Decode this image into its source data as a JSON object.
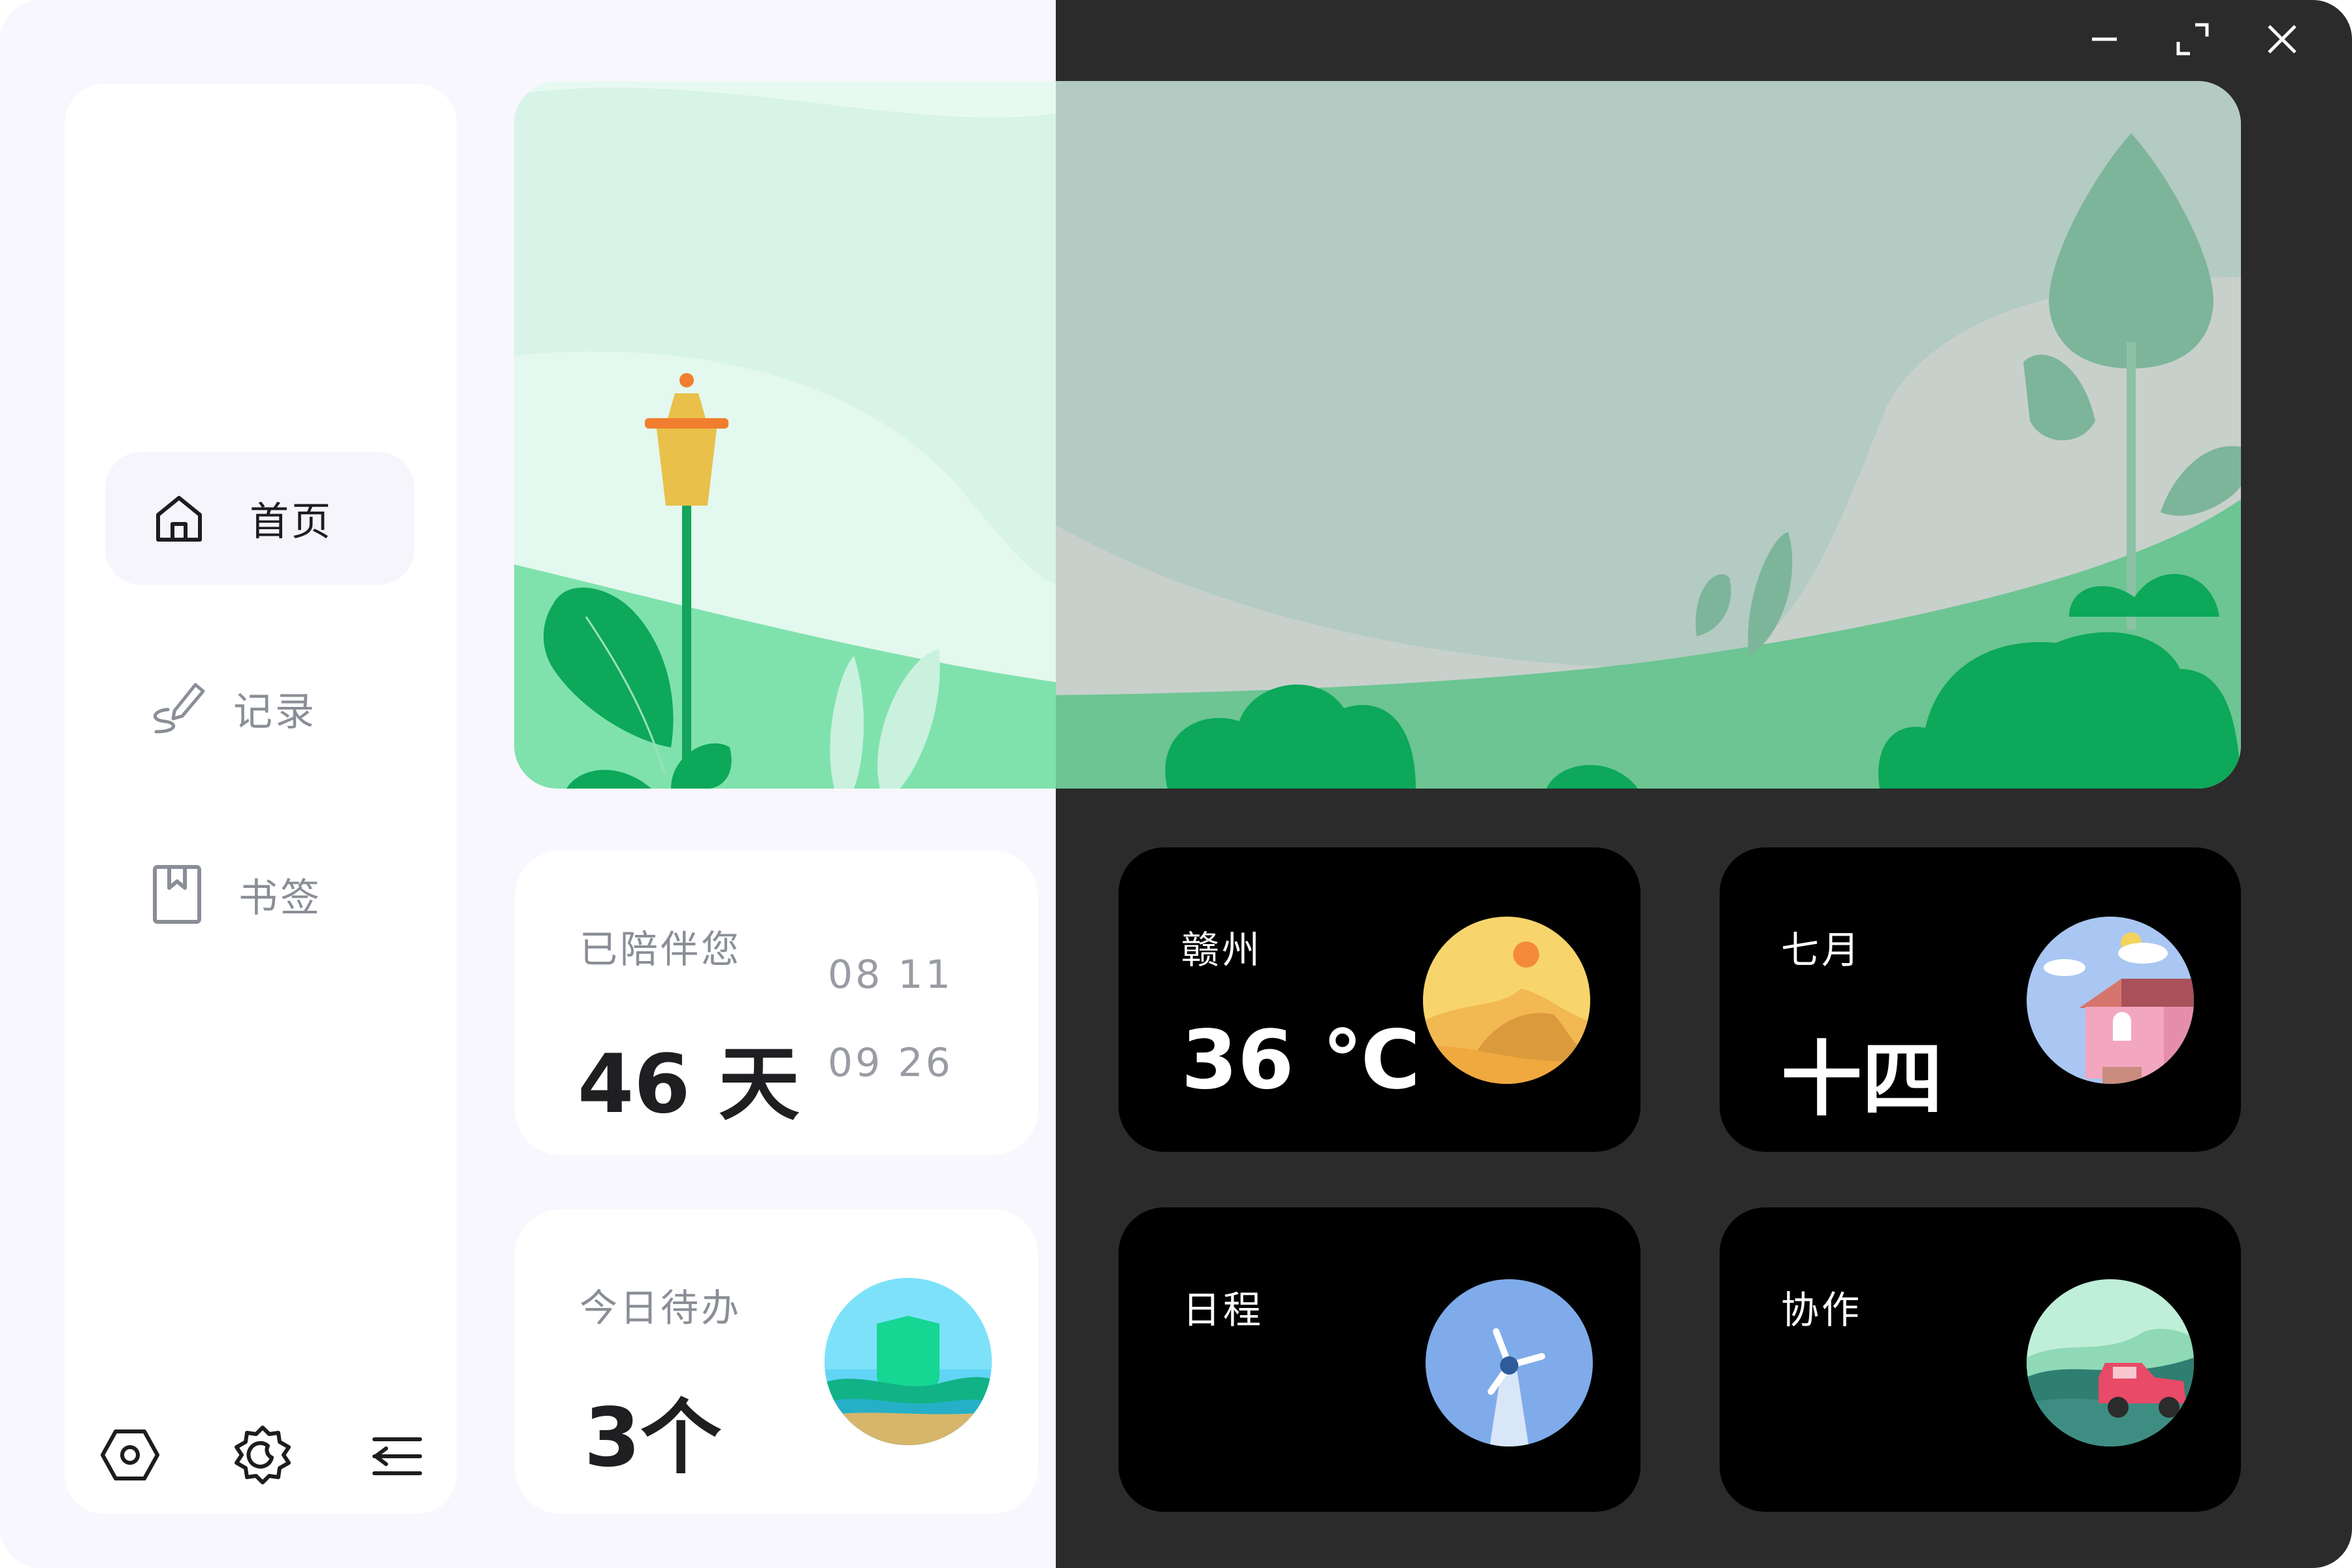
{
  "window": {
    "minimize_icon": "minimize-icon",
    "maximize_icon": "maximize-icon",
    "close_icon": "close-icon"
  },
  "sidebar": {
    "items": [
      {
        "label": "首页",
        "icon": "home-icon",
        "active": true
      },
      {
        "label": "记录",
        "icon": "pen-icon",
        "active": false
      },
      {
        "label": "书签",
        "icon": "bookmark-icon",
        "active": false
      }
    ],
    "footer_icons": [
      "hexagon-settings-icon",
      "theme-gear-icon",
      "collapse-menu-icon"
    ]
  },
  "cards": {
    "companion": {
      "title": "已陪伴您",
      "value": "46 天",
      "date_start": "08  11",
      "date_end": "09  26"
    },
    "todo": {
      "title": "今日待办",
      "value": "3个"
    },
    "weather": {
      "title": "赣州",
      "value": "36 ℃"
    },
    "calendar": {
      "title": "七月",
      "value": "十四"
    },
    "schedule": {
      "title": "日程"
    },
    "collab": {
      "title": "协作"
    }
  },
  "colors": {
    "light_bg": "#F8F7FD",
    "dark_bg": "#2B2B2B",
    "card_dark": "#000000",
    "accent_green": "#0DA85A"
  }
}
